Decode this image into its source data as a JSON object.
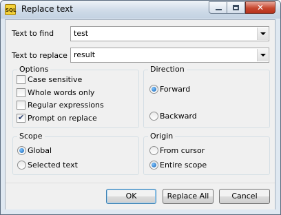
{
  "window": {
    "title": "Replace text",
    "app_icon_text": "SQL"
  },
  "fields": {
    "find": {
      "label": "Text to find",
      "value": "test"
    },
    "replace": {
      "label": "Text to replace",
      "value": "result"
    }
  },
  "options": {
    "title": "Options",
    "case_sensitive": {
      "label": "Case sensitive",
      "checked": false
    },
    "whole_words": {
      "label": "Whole words only",
      "checked": false
    },
    "regex": {
      "label": "Regular expressions",
      "checked": false
    },
    "prompt": {
      "label": "Prompt on replace",
      "checked": true
    }
  },
  "direction": {
    "title": "Direction",
    "forward": "Forward",
    "backward": "Backward",
    "selected": "Forward"
  },
  "scope": {
    "title": "Scope",
    "global": "Global",
    "selected_text": "Selected text",
    "selected": "Global"
  },
  "origin": {
    "title": "Origin",
    "from_cursor": "From cursor",
    "entire_scope": "Entire scope",
    "selected": "Entire scope"
  },
  "buttons": {
    "ok": "OK",
    "replace_all": "Replace All",
    "cancel": "Cancel"
  }
}
